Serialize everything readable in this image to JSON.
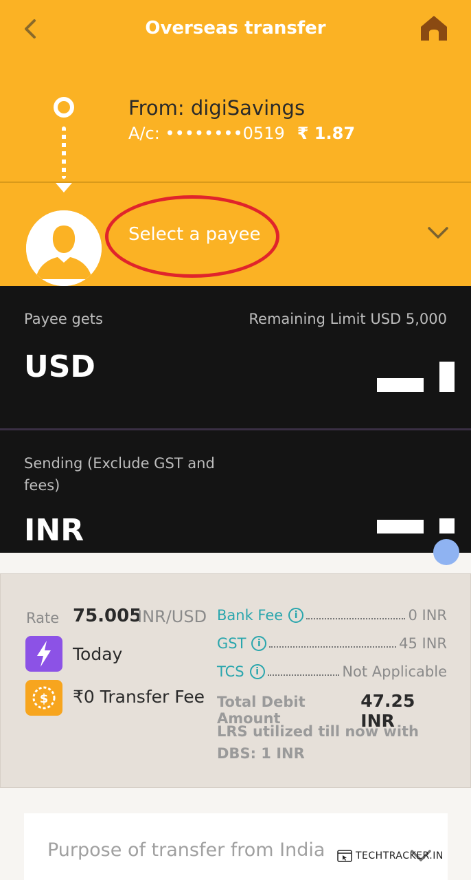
{
  "header": {
    "title": "Overseas transfer",
    "back_icon": "chevron-left-icon",
    "home_icon": "home-icon"
  },
  "from": {
    "title": "From: digiSavings",
    "account": "A/c: ••••••••0519",
    "balance": "₹ 1.87"
  },
  "payee": {
    "placeholder": "Select a payee",
    "avatar_icon": "user-silhouette-icon",
    "dropdown_icon": "chevron-down-icon"
  },
  "receive": {
    "label": "Payee gets",
    "limit": "Remaining Limit USD 5,000",
    "currency": "USD"
  },
  "send": {
    "label": "Sending (Exclude GST and fees)",
    "currency": "INR"
  },
  "summary": {
    "rate_label": "Rate",
    "rate_value": "75.005",
    "rate_unit": "INR/USD",
    "speed": "Today",
    "transfer_fee": "₹0 Transfer Fee",
    "fees": [
      {
        "name": "Bank Fee",
        "value": "0 INR"
      },
      {
        "name": "GST",
        "value": "45 INR"
      },
      {
        "name": "TCS",
        "value": "Not Applicable"
      }
    ],
    "info_glyph": "i",
    "total_label": "Total Debit Amount",
    "total_value": "47.25 INR",
    "lrs": "LRS utilized till now with DBS: 1 INR"
  },
  "purpose": {
    "placeholder": "Purpose of transfer from India"
  },
  "watermark": "TECHTRACKER.IN",
  "colors": {
    "brand": "#fbb224",
    "dark": "#141414",
    "accent": "#2aa6ad",
    "annotation": "#e0242b",
    "lightning_badge": "#8c52e6",
    "coin_badge": "#f7a51e"
  }
}
